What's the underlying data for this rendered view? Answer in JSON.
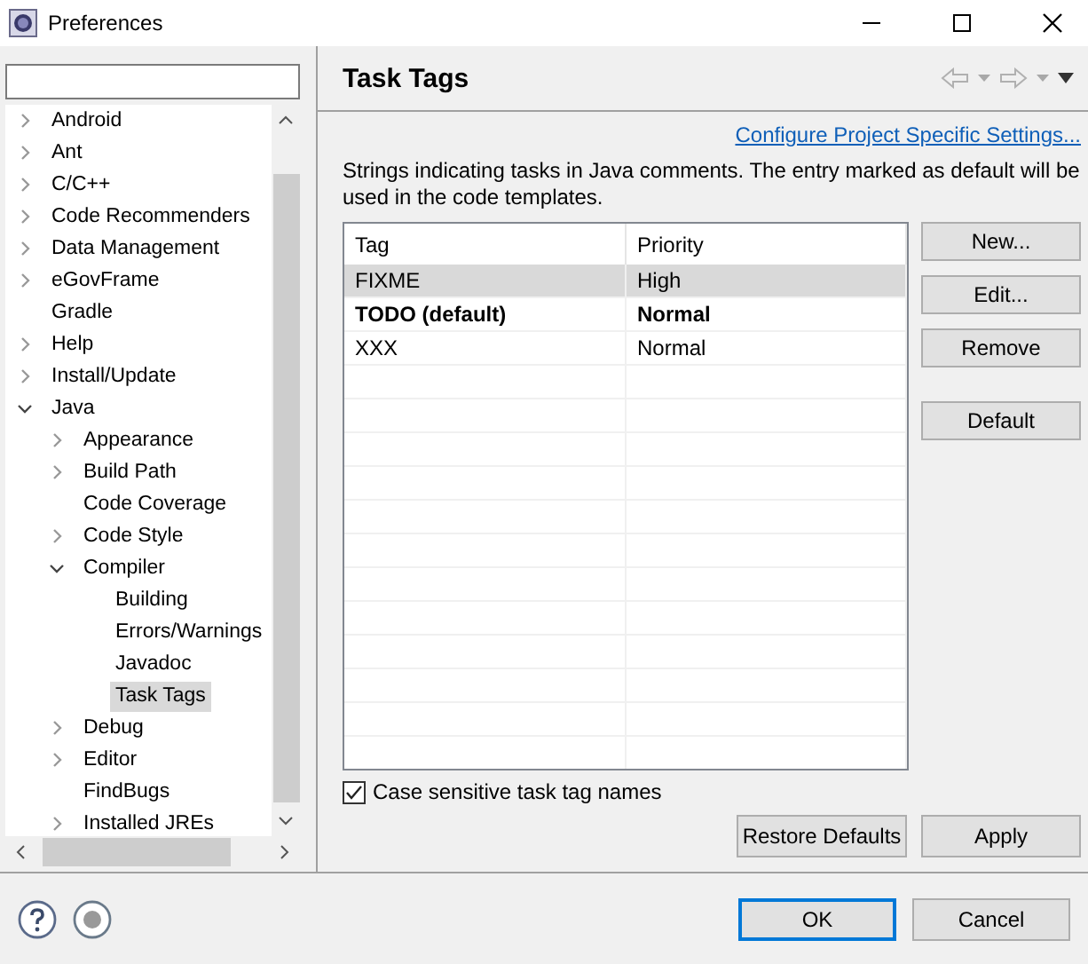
{
  "window": {
    "title": "Preferences"
  },
  "sidebar": {
    "items": [
      {
        "label": "Android",
        "kind": "branch",
        "expanded": false,
        "selected": false
      },
      {
        "label": "Ant",
        "kind": "branch",
        "expanded": false,
        "selected": false
      },
      {
        "label": "C/C++",
        "kind": "branch",
        "expanded": false,
        "selected": false
      },
      {
        "label": "Code Recommenders",
        "kind": "branch",
        "expanded": false,
        "selected": false
      },
      {
        "label": "Data Management",
        "kind": "branch",
        "expanded": false,
        "selected": false
      },
      {
        "label": "eGovFrame",
        "kind": "branch",
        "expanded": false,
        "selected": false
      },
      {
        "label": "Gradle",
        "kind": "leaf",
        "selected": false
      },
      {
        "label": "Help",
        "kind": "branch",
        "expanded": false,
        "selected": false
      },
      {
        "label": "Install/Update",
        "kind": "branch",
        "expanded": false,
        "selected": false
      },
      {
        "label": "Java",
        "kind": "branch",
        "expanded": true,
        "selected": false,
        "children": [
          {
            "label": "Appearance",
            "kind": "branch",
            "expanded": false,
            "selected": false
          },
          {
            "label": "Build Path",
            "kind": "branch",
            "expanded": false,
            "selected": false
          },
          {
            "label": "Code Coverage",
            "kind": "leaf",
            "selected": false
          },
          {
            "label": "Code Style",
            "kind": "branch",
            "expanded": false,
            "selected": false
          },
          {
            "label": "Compiler",
            "kind": "branch",
            "expanded": true,
            "selected": false,
            "children": [
              {
                "label": "Building",
                "kind": "leaf",
                "selected": false
              },
              {
                "label": "Errors/Warnings",
                "kind": "leaf",
                "selected": false
              },
              {
                "label": "Javadoc",
                "kind": "leaf",
                "selected": false
              },
              {
                "label": "Task Tags",
                "kind": "leaf",
                "selected": true
              }
            ]
          },
          {
            "label": "Debug",
            "kind": "branch",
            "expanded": false,
            "selected": false
          },
          {
            "label": "Editor",
            "kind": "branch",
            "expanded": false,
            "selected": false
          },
          {
            "label": "FindBugs",
            "kind": "leaf",
            "selected": false
          },
          {
            "label": "Installed JREs",
            "kind": "branch",
            "expanded": false,
            "selected": false
          }
        ]
      }
    ]
  },
  "page": {
    "title": "Task Tags",
    "link": "Configure Project Specific Settings...",
    "description": "Strings indicating tasks in Java comments. The entry marked as default will be used in the code templates.",
    "table": {
      "columns": [
        "Tag",
        "Priority"
      ],
      "rows": [
        {
          "tag": "FIXME",
          "priority": "High",
          "selected": true,
          "default": false
        },
        {
          "tag": "TODO (default)",
          "priority": "Normal",
          "selected": false,
          "default": true
        },
        {
          "tag": "XXX",
          "priority": "Normal",
          "selected": false,
          "default": false
        }
      ]
    },
    "side_buttons": [
      "New...",
      "Edit...",
      "Remove",
      "Default"
    ],
    "checkbox": {
      "label": "Case sensitive task tag names",
      "checked": true
    },
    "buttons": [
      "Restore Defaults",
      "Apply"
    ]
  },
  "footer": {
    "buttons": [
      {
        "label": "OK",
        "default": true
      },
      {
        "label": "Cancel",
        "default": false
      }
    ]
  }
}
